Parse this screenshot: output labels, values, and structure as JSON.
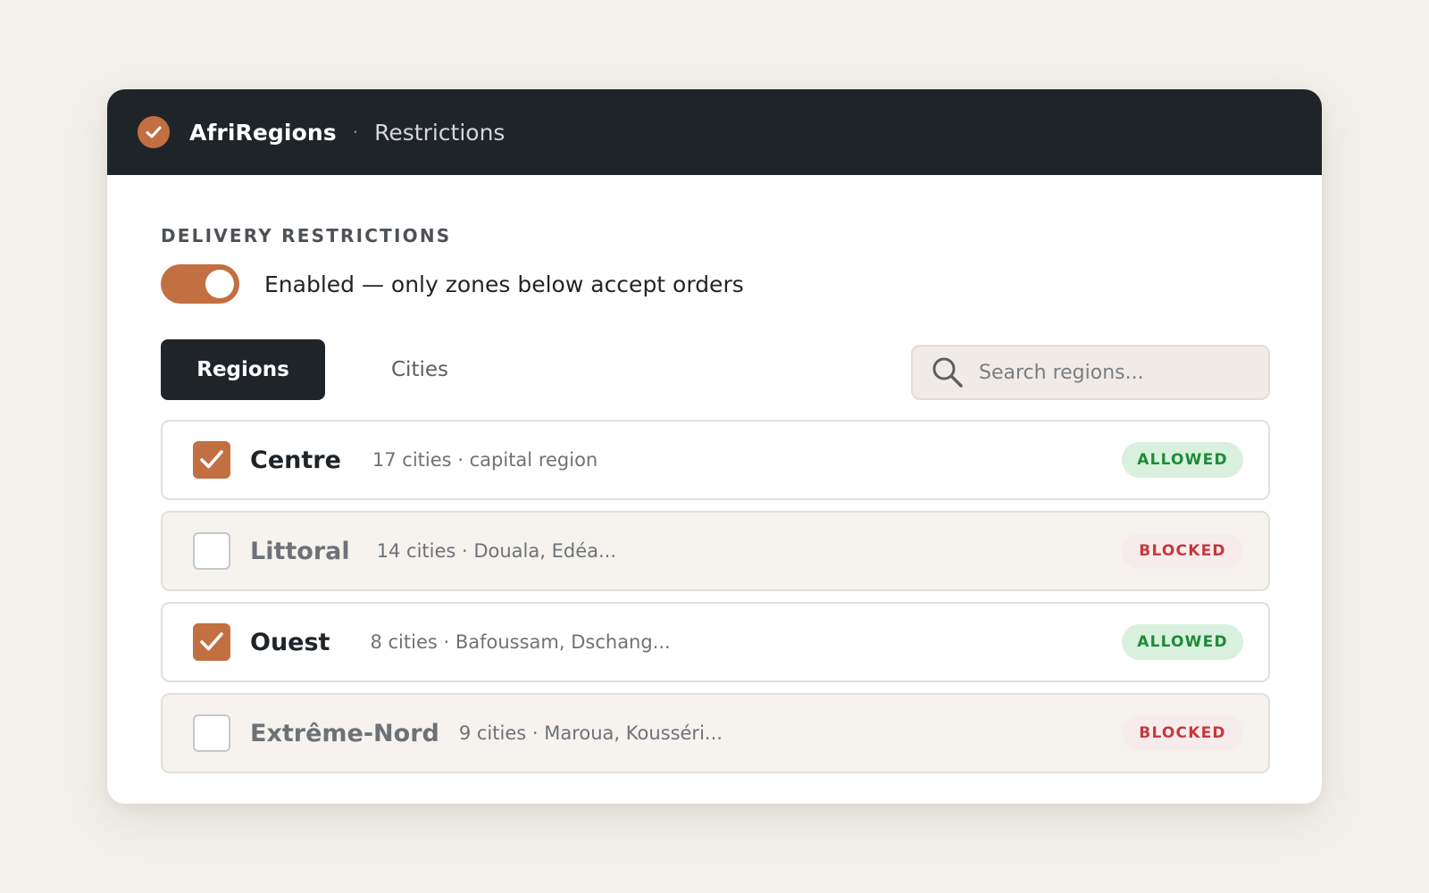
{
  "header": {
    "brand": "AfriRegions",
    "separator": "·",
    "crumb": "Restrictions"
  },
  "section": {
    "title": "DELIVERY RESTRICTIONS",
    "toggle_label": "Enabled — only zones below accept orders",
    "toggle_on": true
  },
  "tabs": [
    {
      "label": "Regions",
      "active": true
    },
    {
      "label": "Cities",
      "active": false
    }
  ],
  "search": {
    "placeholder": "Search regions...",
    "value": ""
  },
  "regions": [
    {
      "name": "Centre",
      "detail": "17 cities · capital region",
      "checked": true,
      "status": "ALLOWED"
    },
    {
      "name": "Littoral",
      "detail": "14 cities · Douala, Edéa...",
      "checked": false,
      "status": "BLOCKED"
    },
    {
      "name": "Ouest",
      "detail": "8 cities · Bafoussam, Dschang...",
      "checked": true,
      "status": "ALLOWED"
    },
    {
      "name": "Extrême-Nord",
      "detail": "9 cities · Maroua, Kousséri...",
      "checked": false,
      "status": "BLOCKED"
    }
  ],
  "colors": {
    "accent": "#c26f41",
    "header_bg": "#1f2429",
    "allowed_bg": "#d9f0de",
    "allowed_text": "#1e8a38",
    "blocked_bg": "#f6eceb",
    "blocked_text": "#c4393d"
  },
  "icons": {
    "logo": "check-circle-icon",
    "search": "search-icon",
    "checkbox_checked": "checkmark-icon"
  }
}
